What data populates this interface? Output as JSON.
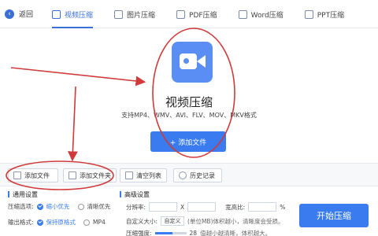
{
  "header": {
    "back_label": "返回",
    "tabs": [
      {
        "label": "视频压缩",
        "active": true
      },
      {
        "label": "图片压缩",
        "active": false
      },
      {
        "label": "PDF压缩",
        "active": false
      },
      {
        "label": "Word压缩",
        "active": false
      },
      {
        "label": "PPT压缩",
        "active": false
      }
    ]
  },
  "main": {
    "title": "视频压缩",
    "formats": "支持MP4、WMV、AVI、FLV、MOV、MKV格式",
    "add_file_label": "+ 添加文件",
    "icon": "video-camera-icon"
  },
  "toolbar": {
    "add_file": "添加文件",
    "add_folder": "添加文件夹",
    "clear_list": "清空列表",
    "history": "历史记录"
  },
  "settings": {
    "general_title": "通用设置",
    "compress_option_label": "压缩选项:",
    "option_small": "缩小优先",
    "option_clear": "清晰优先",
    "output_format_label": "输出格式:",
    "format_keep": "保持原格式",
    "format_mp4": "MP4",
    "advanced_title": "高级设置",
    "resolution_label": "分辨率:",
    "resolution_sep": "X",
    "bitrate_label": "宽高比:",
    "percent": "%",
    "custom_size_label": "自定义大小:",
    "custom_select": "自定义",
    "custom_hint": "(单位MB)体积越小，清晰度会受损。",
    "quality_label": "压缩强度:",
    "quality_value": "28",
    "quality_hint": "值越小越清晰，体积越大。",
    "quality_fraction": 0.56,
    "start_button": "开始压缩"
  },
  "colors": {
    "accent": "#3a7cf0",
    "annotation": "#d03a3a"
  }
}
